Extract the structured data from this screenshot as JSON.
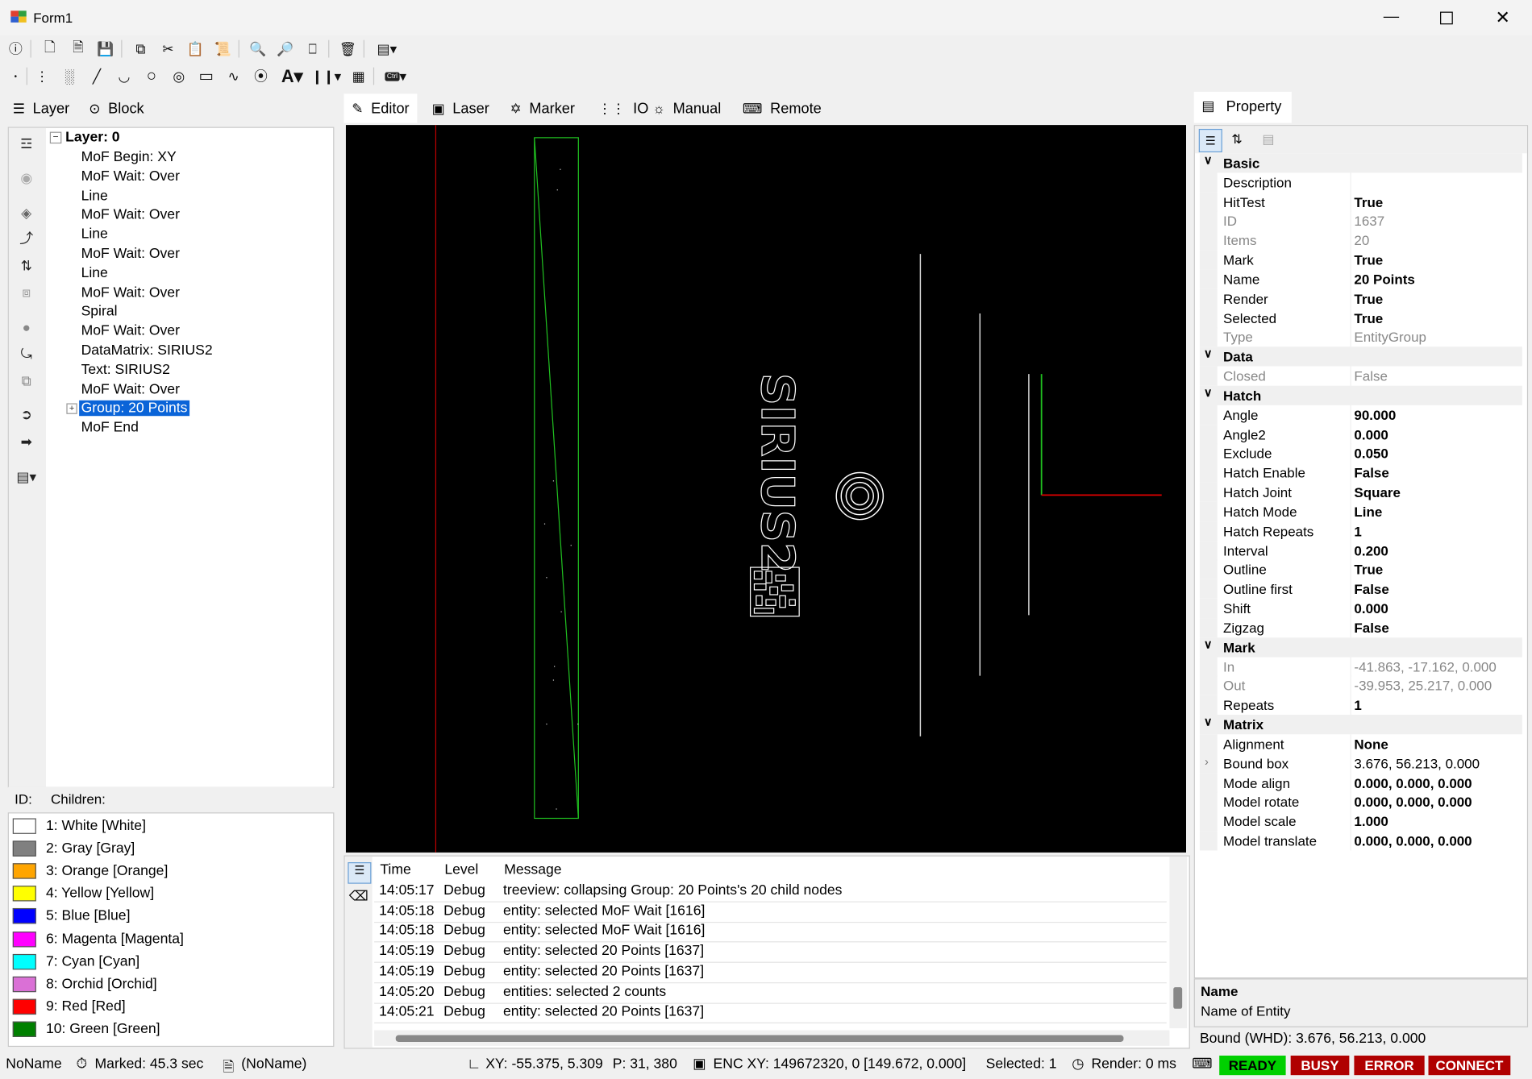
{
  "window": {
    "title": "Form1"
  },
  "left_tabs": [
    "Layer",
    "Block"
  ],
  "center_tabs": [
    "Editor",
    "Laser",
    "Marker",
    "IO",
    "Manual",
    "Remote"
  ],
  "right_tab": "Property",
  "tree": {
    "root": "Layer: 0",
    "items": [
      "MoF Begin: XY",
      "MoF Wait: Over",
      "Line",
      "MoF Wait: Over",
      "Line",
      "MoF Wait: Over",
      "Line",
      "MoF Wait: Over",
      "Spiral",
      "MoF Wait: Over",
      "DataMatrix: SIRIUS2",
      "Text: SIRIUS2",
      "MoF Wait: Over",
      "Group: 20 Points",
      "MoF End"
    ],
    "selected_index": 13
  },
  "info_bar": {
    "id_label": "ID:",
    "children_label": "Children:"
  },
  "colors": [
    {
      "label": "1: White [White]",
      "hex": "#ffffff"
    },
    {
      "label": "2: Gray [Gray]",
      "hex": "#808080"
    },
    {
      "label": "3: Orange [Orange]",
      "hex": "#ffa500"
    },
    {
      "label": "4: Yellow [Yellow]",
      "hex": "#ffff00"
    },
    {
      "label": "5: Blue [Blue]",
      "hex": "#0000ff"
    },
    {
      "label": "6: Magenta [Magenta]",
      "hex": "#ff00ff"
    },
    {
      "label": "7: Cyan [Cyan]",
      "hex": "#00ffff"
    },
    {
      "label": "8: Orchid [Orchid]",
      "hex": "#da70d6"
    },
    {
      "label": "9: Red [Red]",
      "hex": "#ff0000"
    },
    {
      "label": "10: Green [Green]",
      "hex": "#008000"
    }
  ],
  "canvas": {
    "text_label": "SIRIUS2"
  },
  "log": {
    "headers": [
      "Time",
      "Level",
      "Message"
    ],
    "rows": [
      [
        "14:05:17",
        "Debug",
        "treeview: collapsing Group: 20 Points's 20 child nodes"
      ],
      [
        "14:05:18",
        "Debug",
        "entity: selected MoF Wait [1616]"
      ],
      [
        "14:05:18",
        "Debug",
        "entity: selected MoF Wait [1616]"
      ],
      [
        "14:05:19",
        "Debug",
        "entity: selected 20 Points [1637]"
      ],
      [
        "14:05:19",
        "Debug",
        "entity: selected 20 Points [1637]"
      ],
      [
        "14:05:20",
        "Debug",
        "entities: selected 2 counts"
      ],
      [
        "14:05:21",
        "Debug",
        "entity: selected 20 Points [1637]"
      ]
    ]
  },
  "properties": [
    {
      "cat": "Basic"
    },
    {
      "k": "Description",
      "v": "",
      "style": "normal"
    },
    {
      "k": "HitTest",
      "v": "True",
      "style": "bold"
    },
    {
      "k": "ID",
      "v": "1637",
      "style": "gray"
    },
    {
      "k": "Items",
      "v": "20",
      "style": "gray"
    },
    {
      "k": "Mark",
      "v": "True",
      "style": "bold"
    },
    {
      "k": "Name",
      "v": "20 Points",
      "style": "bold"
    },
    {
      "k": "Render",
      "v": "True",
      "style": "bold"
    },
    {
      "k": "Selected",
      "v": "True",
      "style": "bold"
    },
    {
      "k": "Type",
      "v": "EntityGroup",
      "style": "gray"
    },
    {
      "cat": "Data"
    },
    {
      "k": "Closed",
      "v": "False",
      "style": "gray"
    },
    {
      "cat": "Hatch"
    },
    {
      "k": "Angle",
      "v": "90.000",
      "style": "bold"
    },
    {
      "k": "Angle2",
      "v": "0.000",
      "style": "bold"
    },
    {
      "k": "Exclude",
      "v": "0.050",
      "style": "bold"
    },
    {
      "k": "Hatch Enable",
      "v": "False",
      "style": "bold"
    },
    {
      "k": "Hatch Joint",
      "v": "Square",
      "style": "bold"
    },
    {
      "k": "Hatch Mode",
      "v": "Line",
      "style": "bold"
    },
    {
      "k": "Hatch Repeats",
      "v": "1",
      "style": "bold"
    },
    {
      "k": "Interval",
      "v": "0.200",
      "style": "bold"
    },
    {
      "k": "Outline",
      "v": "True",
      "style": "bold"
    },
    {
      "k": "Outline first",
      "v": "False",
      "style": "bold"
    },
    {
      "k": "Shift",
      "v": "0.000",
      "style": "bold"
    },
    {
      "k": "Zigzag",
      "v": "False",
      "style": "bold"
    },
    {
      "cat": "Mark"
    },
    {
      "k": "In",
      "v": "-41.863, -17.162, 0.000",
      "style": "gray"
    },
    {
      "k": "Out",
      "v": "-39.953, 25.217, 0.000",
      "style": "gray"
    },
    {
      "k": "Repeats",
      "v": "1",
      "style": "bold"
    },
    {
      "cat": "Matrix"
    },
    {
      "k": "Alignment",
      "v": "None",
      "style": "bold"
    },
    {
      "k": "Bound box",
      "v": "3.676, 56.213, 0.000",
      "style": "normal",
      "expander": true
    },
    {
      "k": "Mode align",
      "v": "0.000, 0.000, 0.000",
      "style": "bold"
    },
    {
      "k": "Model rotate",
      "v": "0.000, 0.000, 0.000",
      "style": "bold"
    },
    {
      "k": "Model scale",
      "v": "1.000",
      "style": "bold"
    },
    {
      "k": "Model translate",
      "v": "0.000, 0.000, 0.000",
      "style": "bold"
    }
  ],
  "prop_help": {
    "title": "Name",
    "desc": "Name of Entity"
  },
  "bound_text": "Bound (WHD): 3.676, 56.213, 0.000",
  "status": {
    "doc": "NoName",
    "marked": "Marked: 45.3 sec",
    "file": "(NoName)",
    "xy": "XY: -55.375, 5.309",
    "p": "P: 31, 380",
    "enc": "ENC XY: 149672320, 0 [149.672, 0.000]",
    "selected": "Selected: 1",
    "render": "Render: 0 ms",
    "ready": "READY",
    "busy": "BUSY",
    "error": "ERROR",
    "connect": "CONNECT"
  }
}
